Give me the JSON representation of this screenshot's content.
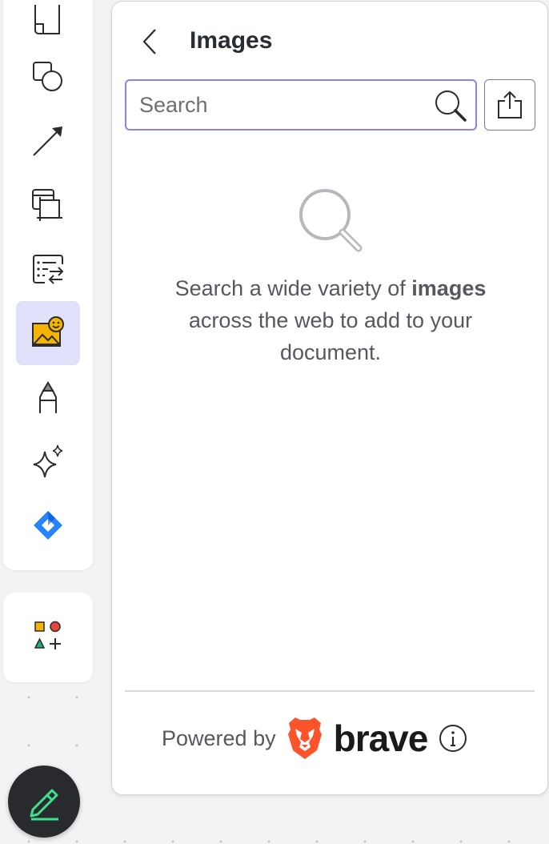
{
  "panel": {
    "title": "Images",
    "search": {
      "placeholder": "Search",
      "value": ""
    },
    "empty_state": {
      "text_before": "Search a wide variety of ",
      "text_bold": "images",
      "text_after": " across the web to add to your document."
    },
    "footer": {
      "powered_by": "Powered by",
      "brand": "brave"
    }
  },
  "colors": {
    "accent": "#8a84e2",
    "active_tool_bg": "#e1e1fb",
    "fab_bg": "#282a2e",
    "brave_orange": "#fb542b",
    "jira_blue": "#2684ff"
  },
  "toolbar": {
    "tools": [
      {
        "name": "page-icon",
        "active": false
      },
      {
        "name": "shapes-icon",
        "active": false
      },
      {
        "name": "arrow-icon",
        "active": false
      },
      {
        "name": "frame-icon",
        "active": false
      },
      {
        "name": "data-import-icon",
        "active": false
      },
      {
        "name": "images-icon",
        "active": true
      },
      {
        "name": "marker-icon",
        "active": false
      },
      {
        "name": "ai-sparkle-icon",
        "active": false
      },
      {
        "name": "jira-icon",
        "active": false
      }
    ],
    "secondary": [
      {
        "name": "shape-library-icon"
      }
    ],
    "fab": {
      "name": "edit-pen-icon"
    }
  }
}
